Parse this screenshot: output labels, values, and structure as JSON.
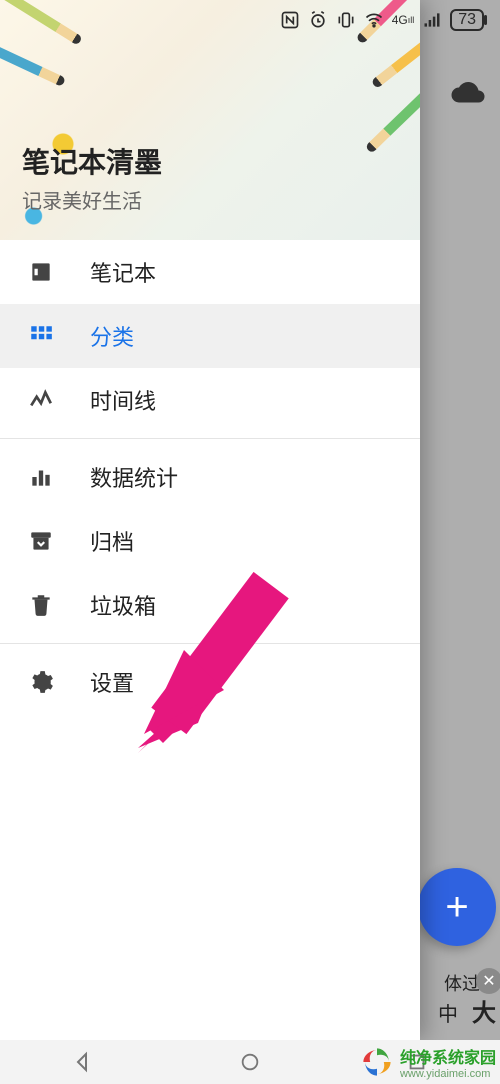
{
  "statusbar": {
    "nfc": "NFC",
    "network": "4G",
    "battery": "73"
  },
  "drawer": {
    "title": "笔记本清墨",
    "subtitle": "记录美好生活",
    "items": [
      {
        "icon": "notebook-icon",
        "label": "笔记本"
      },
      {
        "icon": "grid-icon",
        "label": "分类"
      },
      {
        "icon": "timeline-icon",
        "label": "时间线"
      },
      {
        "icon": "stats-icon",
        "label": "数据统计"
      },
      {
        "icon": "archive-icon",
        "label": "归档"
      },
      {
        "icon": "trash-icon",
        "label": "垃圾箱"
      },
      {
        "icon": "gear-icon",
        "label": "设置"
      }
    ],
    "selected_index": 1
  },
  "behind": {
    "fab": "+",
    "hint_text": "体过小",
    "size_mid": "中",
    "size_big": "大"
  },
  "watermark": {
    "line1": "纯净系统家园",
    "line2": "www.yidaimei.com"
  }
}
